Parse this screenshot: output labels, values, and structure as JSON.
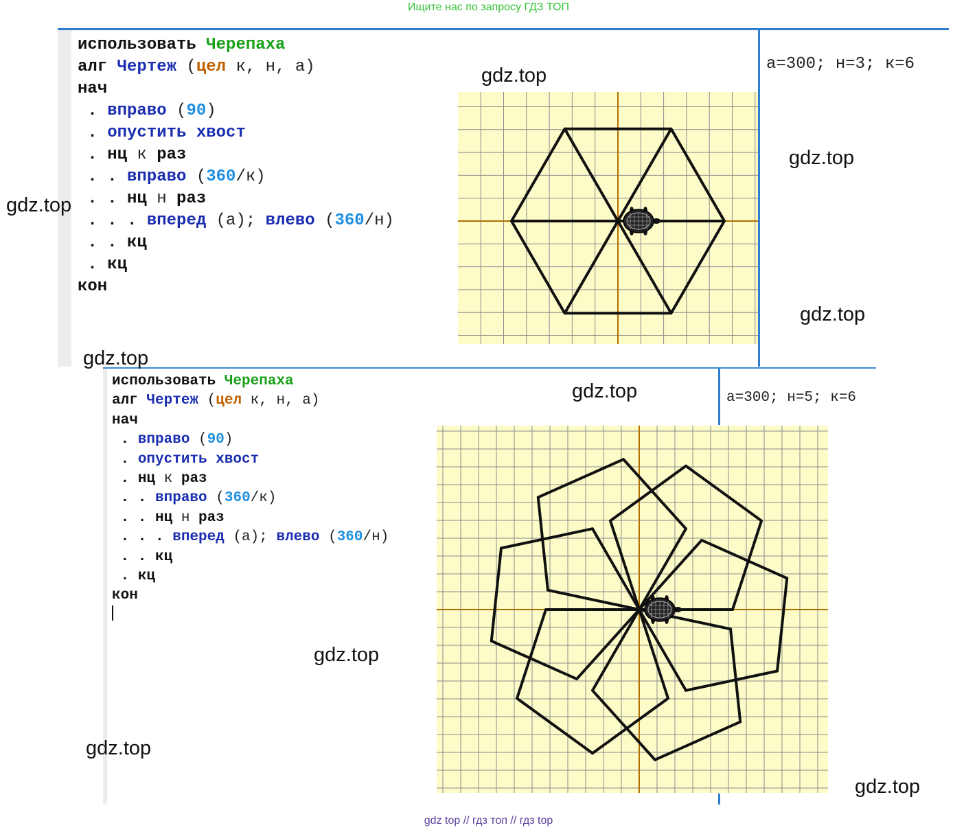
{
  "header_note": "Ищите нас по запросу ГДЗ ТОП",
  "footer_note": "gdz top  //  гдз топ  //  гдз top",
  "watermark": "gdz.top",
  "colors": {
    "divider": "#2f7fd0",
    "grid_bg": "#fdfbc8",
    "grid_line": "#8c8c8c",
    "axis": "#b07000",
    "keyword": "#111111",
    "module": "#19a019",
    "procedure": "#1b2eb0",
    "type": "#c06000",
    "number": "#1e8fe0"
  },
  "panel1": {
    "code": [
      [
        {
          "t": "использовать ",
          "c": "kw"
        },
        {
          "t": "Черепаха",
          "c": "mod"
        }
      ],
      [
        {
          "t": "алг ",
          "c": "kw"
        },
        {
          "t": "Чертеж",
          "c": "fn"
        },
        {
          "t": " (",
          "c": "var"
        },
        {
          "t": "цел",
          "c": "ty"
        },
        {
          "t": " к, н, а)",
          "c": "var"
        }
      ],
      [
        {
          "t": "нач",
          "c": "kw"
        }
      ],
      [
        {
          "t": " . ",
          "c": "dot"
        },
        {
          "t": "вправо",
          "c": "fn"
        },
        {
          "t": " (",
          "c": "var"
        },
        {
          "t": "90",
          "c": "num"
        },
        {
          "t": ")",
          "c": "var"
        }
      ],
      [
        {
          "t": " . ",
          "c": "dot"
        },
        {
          "t": "опустить хвост",
          "c": "fn"
        }
      ],
      [
        {
          "t": " . ",
          "c": "dot"
        },
        {
          "t": "нц",
          "c": "kw"
        },
        {
          "t": " к ",
          "c": "var"
        },
        {
          "t": "раз",
          "c": "kw"
        }
      ],
      [
        {
          "t": " . . ",
          "c": "dot"
        },
        {
          "t": "вправо",
          "c": "fn"
        },
        {
          "t": " (",
          "c": "var"
        },
        {
          "t": "360",
          "c": "num"
        },
        {
          "t": "/к)",
          "c": "var"
        }
      ],
      [
        {
          "t": " . . ",
          "c": "dot"
        },
        {
          "t": "нц",
          "c": "kw"
        },
        {
          "t": " н ",
          "c": "var"
        },
        {
          "t": "раз",
          "c": "kw"
        }
      ],
      [
        {
          "t": " . . . ",
          "c": "dot"
        },
        {
          "t": "вперед",
          "c": "fn"
        },
        {
          "t": " (а); ",
          "c": "var"
        },
        {
          "t": "влево",
          "c": "fn"
        },
        {
          "t": " (",
          "c": "var"
        },
        {
          "t": "360",
          "c": "num"
        },
        {
          "t": "/н)",
          "c": "var"
        }
      ],
      [
        {
          "t": " . . ",
          "c": "dot"
        },
        {
          "t": "кц",
          "c": "kw"
        }
      ],
      [
        {
          "t": " . ",
          "c": "dot"
        },
        {
          "t": "кц",
          "c": "kw"
        }
      ],
      [
        {
          "t": "кон",
          "c": "kw"
        }
      ]
    ],
    "params": "а=300; н=3; к=6"
  },
  "panel2": {
    "code": [
      [
        {
          "t": "использовать ",
          "c": "kw"
        },
        {
          "t": "Черепаха",
          "c": "mod"
        }
      ],
      [
        {
          "t": "алг ",
          "c": "kw"
        },
        {
          "t": "Чертеж",
          "c": "fn"
        },
        {
          "t": " (",
          "c": "var"
        },
        {
          "t": "цел",
          "c": "ty"
        },
        {
          "t": " к, н, а)",
          "c": "var"
        }
      ],
      [
        {
          "t": "нач",
          "c": "kw"
        }
      ],
      [
        {
          "t": " . ",
          "c": "dot"
        },
        {
          "t": "вправо",
          "c": "fn"
        },
        {
          "t": " (",
          "c": "var"
        },
        {
          "t": "90",
          "c": "num"
        },
        {
          "t": ")",
          "c": "var"
        }
      ],
      [
        {
          "t": " . ",
          "c": "dot"
        },
        {
          "t": "опустить хвост",
          "c": "fn"
        }
      ],
      [
        {
          "t": " . ",
          "c": "dot"
        },
        {
          "t": "нц",
          "c": "kw"
        },
        {
          "t": " к ",
          "c": "var"
        },
        {
          "t": "раз",
          "c": "kw"
        }
      ],
      [
        {
          "t": " . . ",
          "c": "dot"
        },
        {
          "t": "вправо",
          "c": "fn"
        },
        {
          "t": " (",
          "c": "var"
        },
        {
          "t": "360",
          "c": "num"
        },
        {
          "t": "/к)",
          "c": "var"
        }
      ],
      [
        {
          "t": " . . ",
          "c": "dot"
        },
        {
          "t": "нц",
          "c": "kw"
        },
        {
          "t": " н ",
          "c": "var"
        },
        {
          "t": "раз",
          "c": "kw"
        }
      ],
      [
        {
          "t": " . . . ",
          "c": "dot"
        },
        {
          "t": "вперед",
          "c": "fn"
        },
        {
          "t": " (а); ",
          "c": "var"
        },
        {
          "t": "влево",
          "c": "fn"
        },
        {
          "t": " (",
          "c": "var"
        },
        {
          "t": "360",
          "c": "num"
        },
        {
          "t": "/н)",
          "c": "var"
        }
      ],
      [
        {
          "t": " . . ",
          "c": "dot"
        },
        {
          "t": "кц",
          "c": "kw"
        }
      ],
      [
        {
          "t": " . ",
          "c": "dot"
        },
        {
          "t": "кц",
          "c": "kw"
        }
      ],
      [
        {
          "t": "кон",
          "c": "kw"
        }
      ]
    ],
    "params": "а=300; н=5; к=6"
  },
  "drawings": [
    {
      "program": "Чертеж",
      "k": 6,
      "n": 3,
      "a": 300,
      "icon": "turtle-icon"
    },
    {
      "program": "Чертеж",
      "k": 6,
      "n": 5,
      "a": 300,
      "icon": "turtle-icon"
    }
  ]
}
